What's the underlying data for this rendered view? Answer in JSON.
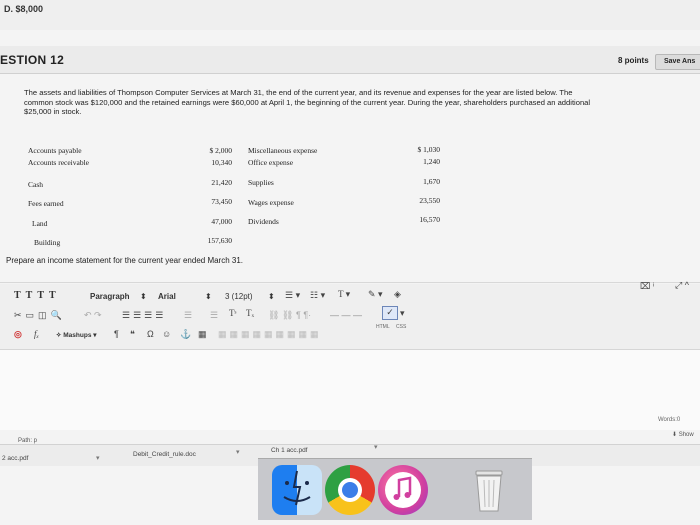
{
  "previous": {
    "answer_option": "D. $8,000"
  },
  "question": {
    "title": "ESTION 12",
    "points": "8 points",
    "save_label": "Save Ans",
    "prompt_lines": [
      "The assets and liabilities of Thompson Computer Services at March 31, the end of the current year, and its revenue and expenses for the year are listed below. The",
      "common stock was $120,000 and the retained earnings were $60,000 at April 1, the beginning of the current year. During the year, shareholders purchased an additional",
      "$25,000 in stock."
    ],
    "accounts_left": [
      {
        "name": "Accounts payable",
        "value": "$ 2,000"
      },
      {
        "name": "Accounts receivable",
        "value": "10,340"
      },
      {
        "name": "Cash",
        "value": "21,420"
      },
      {
        "name": "Fees earned",
        "value": "73,450"
      },
      {
        "name": "Land",
        "value": "47,000"
      },
      {
        "name": "Building",
        "value": "157,630"
      }
    ],
    "accounts_right": [
      {
        "name": "Miscellaneous expense",
        "value": "$ 1,030"
      },
      {
        "name": "Office expense",
        "value": "1,240"
      },
      {
        "name": "Supplies",
        "value": "1,670"
      },
      {
        "name": "Wages expense",
        "value": "23,550"
      },
      {
        "name": "Dividends",
        "value": "16,570"
      }
    ],
    "instruction": "Prepare an income statement for the current year ended March 31."
  },
  "editor": {
    "format_block": "Paragraph",
    "font_family": "Arial",
    "font_size": "3 (12pt)",
    "mashups_label": "Mashups",
    "html_label": "HTML",
    "css_label": "CSS",
    "words_label": "Words:0",
    "path_label": "Path: p",
    "show_label": "Show"
  },
  "downloads": [
    {
      "name": "2 acc.pdf"
    },
    {
      "name": "Debit_Credit_rule.doc"
    },
    {
      "name": "Ch 1 acc.pdf"
    }
  ],
  "dock": {
    "apps": [
      "finder-icon",
      "chrome-icon",
      "itunes-icon",
      "trash-icon"
    ]
  }
}
